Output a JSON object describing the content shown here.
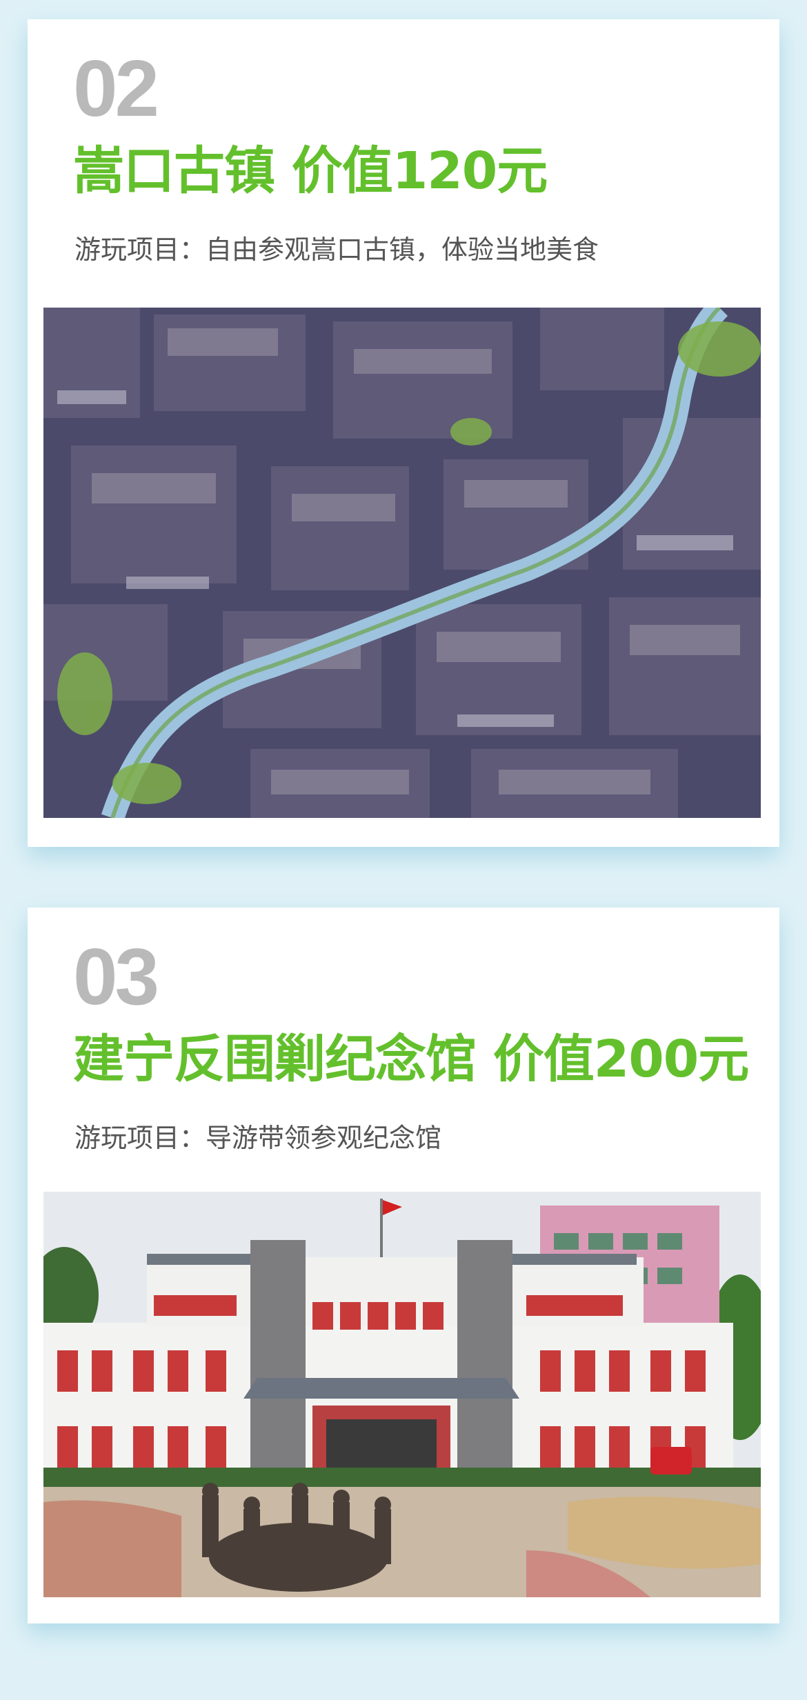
{
  "sections": [
    {
      "number": "02",
      "title": "嵩口古镇 价值120元",
      "description": "游玩项目：自由参观嵩口古镇，体验当地美食",
      "photo_subject": "aerial-ancient-town-photo"
    },
    {
      "number": "03",
      "title": "建宁反围剿纪念馆 价值200元",
      "description": "游玩项目：导游带领参观纪念馆",
      "photo_subject": "memorial-hall-photo"
    }
  ],
  "colors": {
    "background": "#dff1f7",
    "title_green": "#63c02c",
    "number_gray": "#b9b9b9",
    "description_gray": "#555555"
  }
}
